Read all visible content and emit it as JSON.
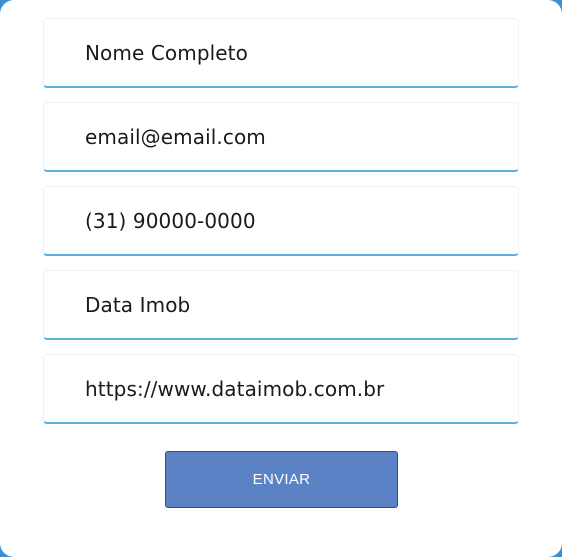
{
  "form": {
    "fields": [
      {
        "name": "name",
        "value": "Nome Completo"
      },
      {
        "name": "email",
        "value": "email@email.com"
      },
      {
        "name": "phone",
        "value": "(31) 90000-0000"
      },
      {
        "name": "company",
        "value": "Data Imob"
      },
      {
        "name": "website",
        "value": "https://www.dataimob.com.br"
      }
    ],
    "submit_label": "ENVIAR"
  },
  "colors": {
    "field_underline": "#5aaee0",
    "button_bg": "#5b82c4",
    "button_border": "#2e4f7f",
    "frame_accent": "#3c8fd3"
  }
}
